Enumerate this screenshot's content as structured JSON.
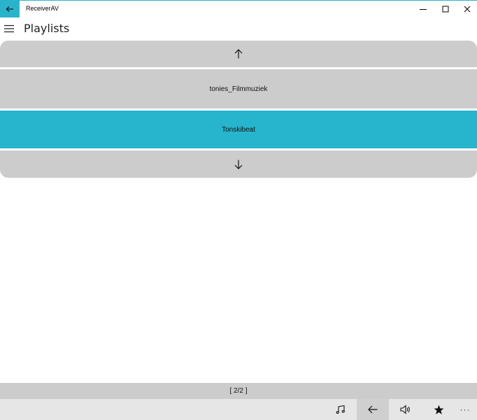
{
  "window": {
    "title": "ReceiverAV"
  },
  "header": {
    "title": "Playlists"
  },
  "playlists": [
    {
      "name": "tonies_Filmmuziek",
      "selected": false
    },
    {
      "name": "Tonskibeat",
      "selected": true
    }
  ],
  "pager": {
    "text": "[ 2/2 ]"
  },
  "commandbar": {
    "buttons": [
      {
        "icon": "music-icon"
      },
      {
        "icon": "back-arrow-icon"
      },
      {
        "icon": "volume-icon"
      },
      {
        "icon": "star-icon"
      }
    ],
    "more": "···"
  },
  "colors": {
    "accent": "#26b5cd",
    "row": "#cccccc",
    "commandbar": "#e6e6e6"
  }
}
